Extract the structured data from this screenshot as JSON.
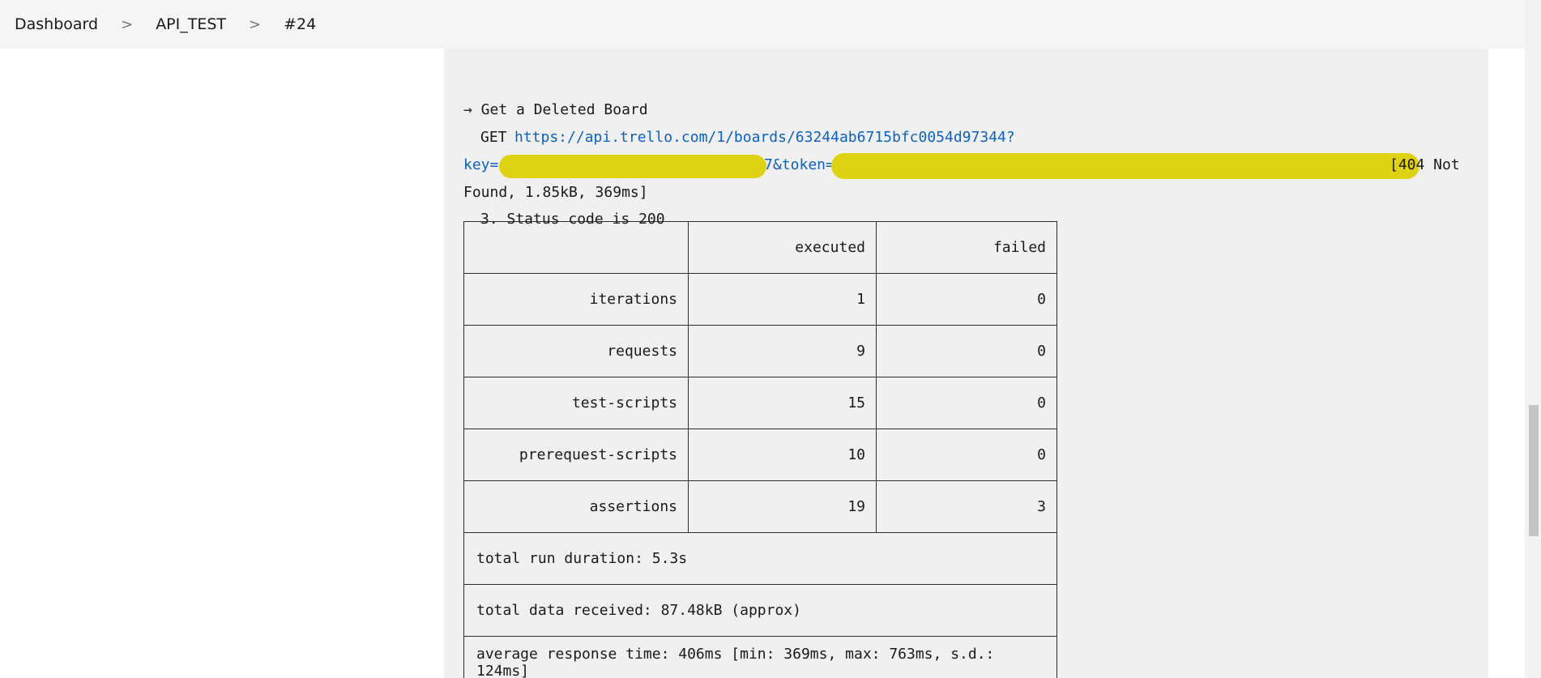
{
  "breadcrumb": {
    "items": [
      "Dashboard",
      "API_TEST",
      "#24"
    ],
    "separator": ">"
  },
  "console": {
    "request_title": "→ Get a Deleted Board",
    "method": "GET",
    "url_line1": "https://api.trello.com/1/boards/63244ab6715bfc0054d97344?",
    "url_key_label": "key=",
    "url_key_tail": "7",
    "url_token_label": "&token=",
    "response_status_part1": "[404 Not",
    "response_status_part2": "Found, 1.85kB, 369ms]",
    "assertion": "3. Status code is 200"
  },
  "summary_table": {
    "headers": [
      "",
      "executed",
      "failed"
    ],
    "rows": [
      {
        "label": "iterations",
        "executed": "1",
        "failed": "0"
      },
      {
        "label": "requests",
        "executed": "9",
        "failed": "0"
      },
      {
        "label": "test-scripts",
        "executed": "15",
        "failed": "0"
      },
      {
        "label": "prerequest-scripts",
        "executed": "10",
        "failed": "0"
      },
      {
        "label": "assertions",
        "executed": "19",
        "failed": "3"
      }
    ],
    "total_run_duration": "total run duration: 5.3s",
    "total_data_received": "total data received: 87.48kB (approx)",
    "average_response_time": "average response time: 406ms [min: 369ms, max: 763ms, s.d.: 124ms]"
  },
  "colors": {
    "link": "#0b62c2",
    "redaction": "#dfd212",
    "console_bg": "#f0f0f0",
    "header_bg": "#f5f5f5"
  }
}
